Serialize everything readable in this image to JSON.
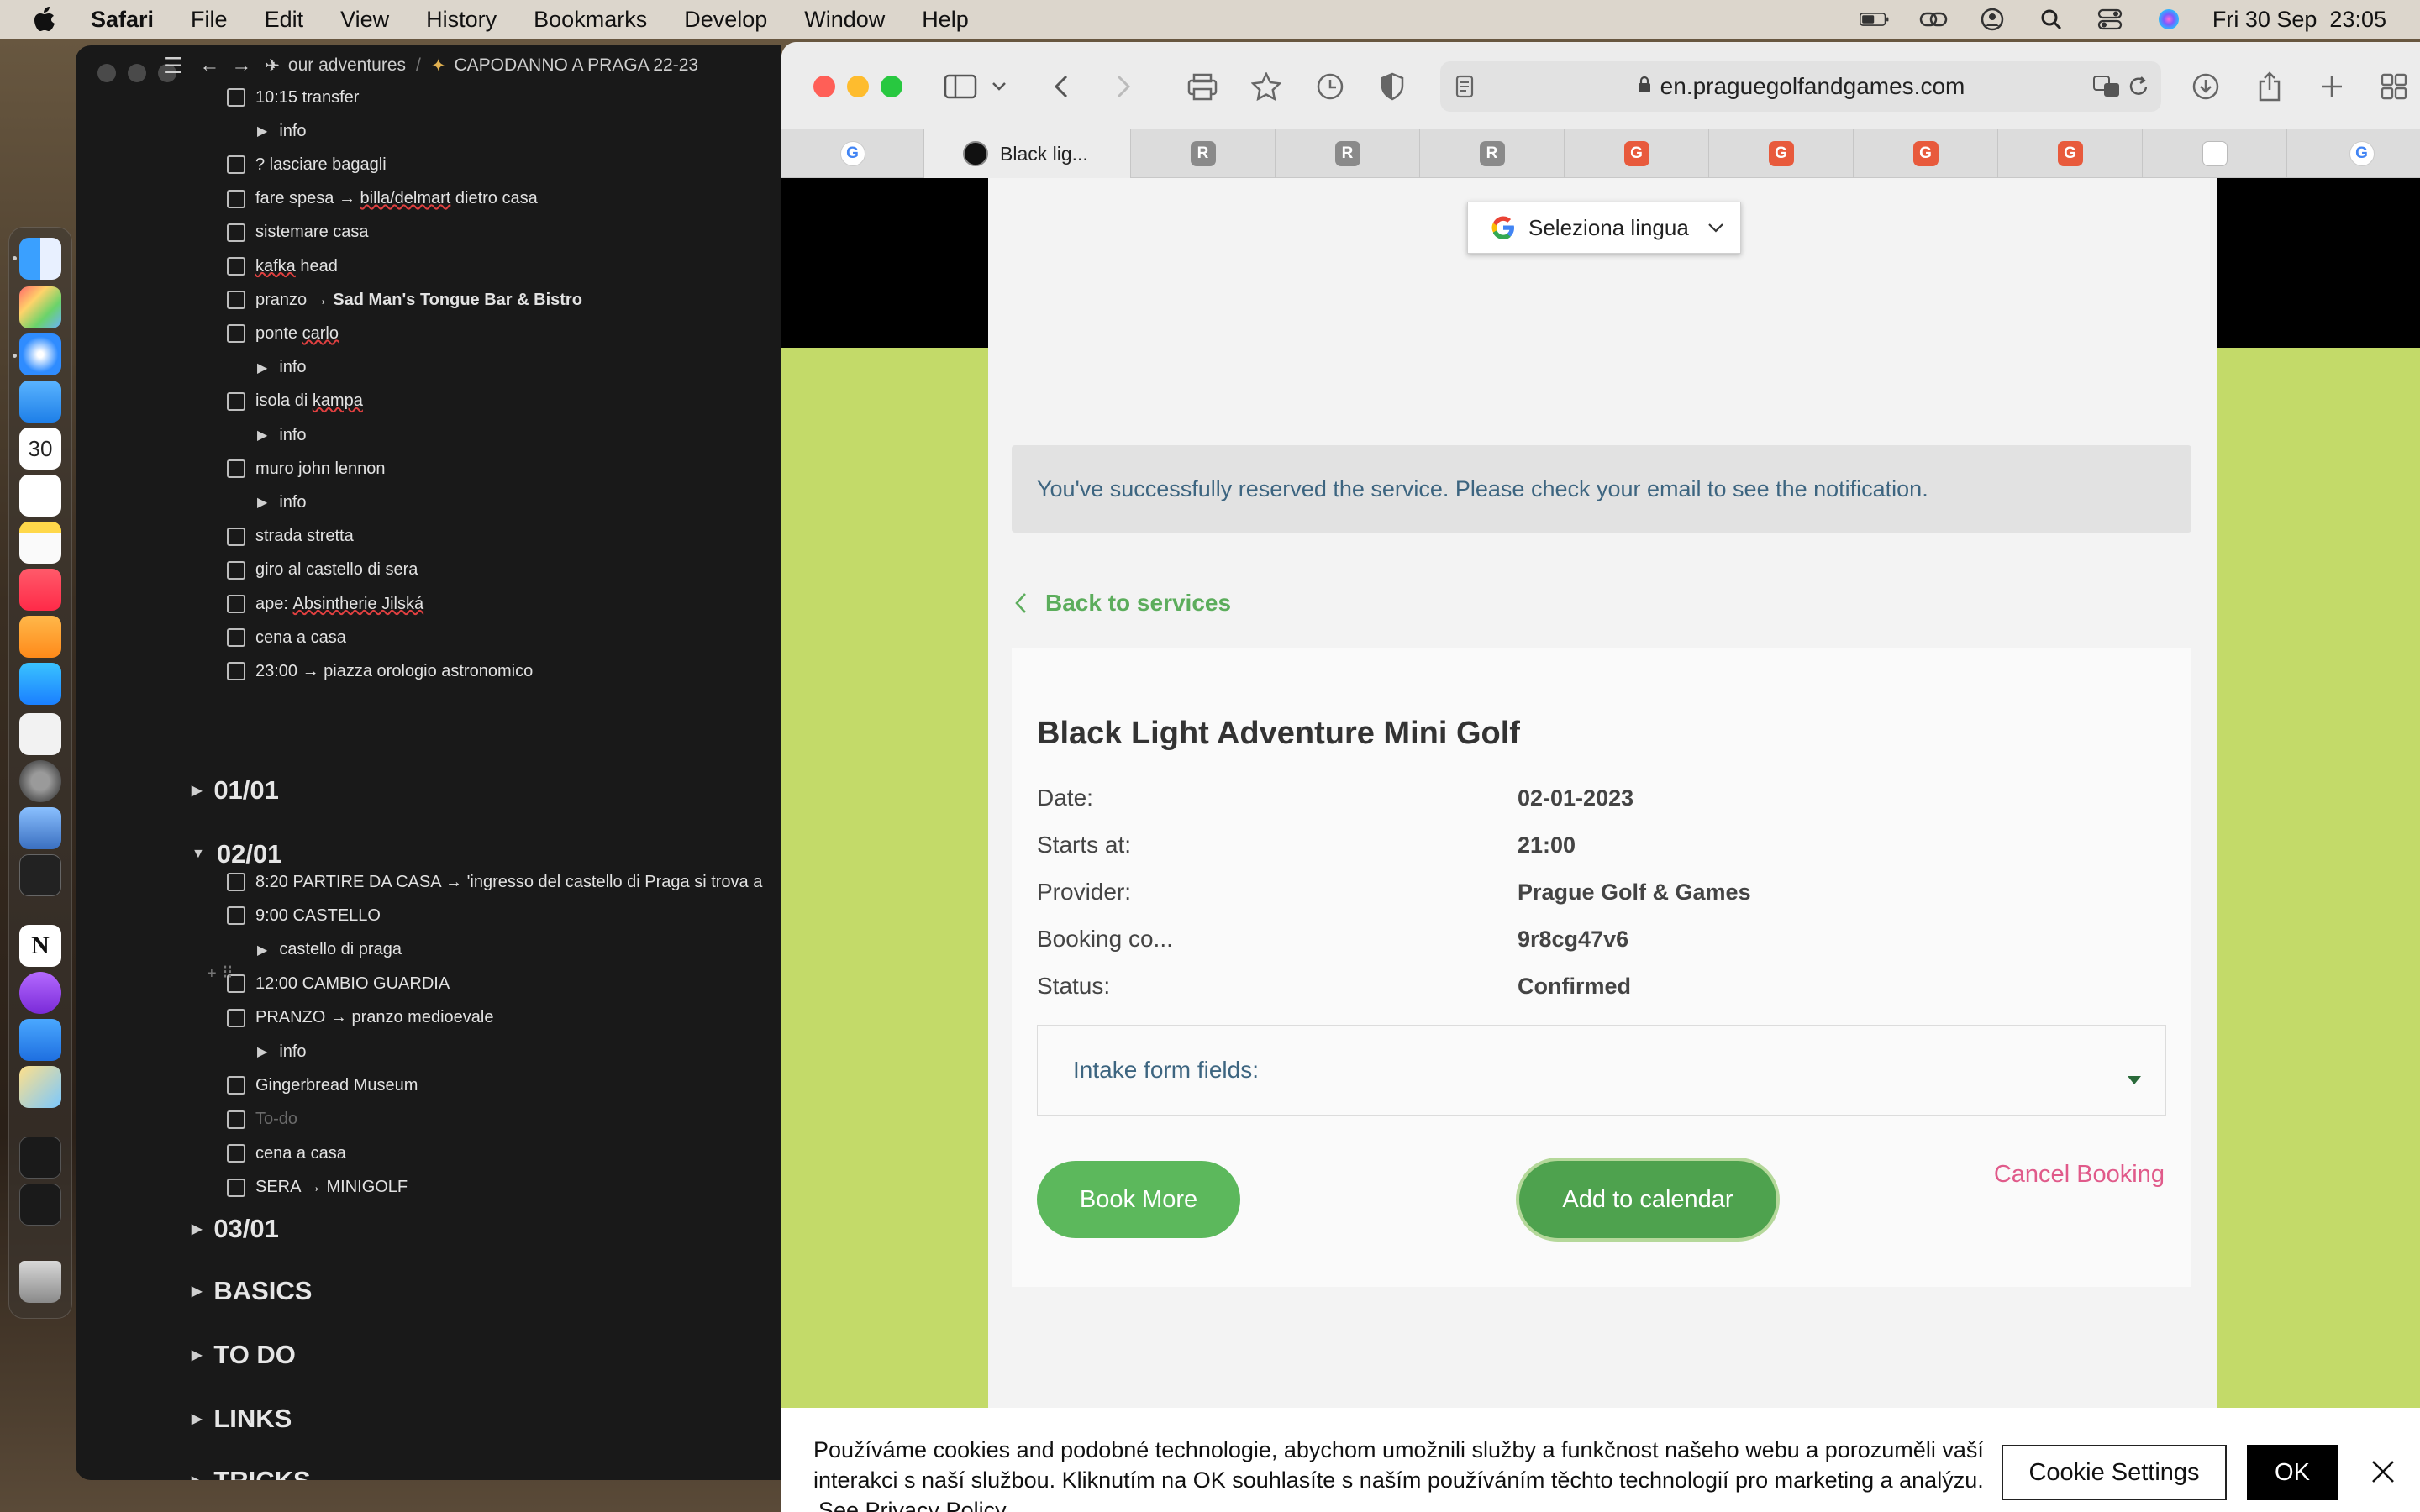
{
  "menubar": {
    "app_name": "Safari",
    "items": [
      "File",
      "Edit",
      "View",
      "History",
      "Bookmarks",
      "Develop",
      "Window",
      "Help"
    ],
    "clock": "Fri 30 Sep  23:05"
  },
  "dock": {
    "calendar_day": "30",
    "apps": [
      "finder",
      "launchpad",
      "safari",
      "mail",
      "calendar",
      "reminders",
      "notes",
      "music",
      "pages",
      "app-store",
      "textedit",
      "system-preferences",
      "preview",
      "terminal",
      "notion",
      "podcasts",
      "keynote",
      "other",
      "window-1",
      "window-2",
      "trash"
    ]
  },
  "notion": {
    "breadcrumb": [
      "our adventures",
      "CAPODANNO A PRAGA 22-23"
    ],
    "rows_a": [
      {
        "type": "todo",
        "text": "10:15 transfer"
      },
      {
        "type": "toggle",
        "text": "info"
      },
      {
        "type": "todo",
        "text": "? lasciare bagagli"
      },
      {
        "type": "todo",
        "text_pre": "fare spesa → ",
        "text_ul": "billa/delmart",
        "text_post": " dietro casa"
      },
      {
        "type": "todo",
        "text": "sistemare casa"
      },
      {
        "type": "todo",
        "text_ul": "kafka",
        "text_post": " head"
      },
      {
        "type": "todo",
        "text_pre": "pranzo → ",
        "text_bold": "Sad Man's Tongue Bar & Bistro"
      },
      {
        "type": "todo",
        "text_pre": "ponte ",
        "text_ul": "carlo"
      },
      {
        "type": "toggle",
        "text": "info"
      },
      {
        "type": "todo",
        "text_pre": "isola di ",
        "text_ul": "kampa"
      },
      {
        "type": "toggle",
        "text": "info"
      },
      {
        "type": "todo",
        "text": "muro john lennon"
      },
      {
        "type": "toggle",
        "text": "info"
      },
      {
        "type": "todo",
        "text": "strada stretta"
      },
      {
        "type": "todo",
        "text": "giro al castello di sera"
      },
      {
        "type": "todo",
        "text_pre": "ape: ",
        "text_ul": "Absintherie Jilská"
      },
      {
        "type": "todo",
        "text": "cena a casa"
      },
      {
        "type": "todo",
        "text": "23:00 → piazza orologio astronomico"
      }
    ],
    "sections": {
      "s1": "01/01",
      "s2": "02/01",
      "s3": "03/01",
      "s4": "BASICS",
      "s5": "TO DO",
      "s6": "LINKS",
      "s7": "TRICKS"
    },
    "rows_b": [
      {
        "type": "todo",
        "text": "8:20 PARTIRE DA CASA → 'ingresso del castello di Praga si trova a"
      },
      {
        "type": "todo",
        "text": "9:00 CASTELLO"
      },
      {
        "type": "toggle",
        "text": "castello di praga"
      },
      {
        "type": "todo",
        "text": "12:00 CAMBIO GUARDIA"
      },
      {
        "type": "todo",
        "text": "PRANZO → pranzo medioevale"
      },
      {
        "type": "toggle",
        "text": "info"
      },
      {
        "type": "todo",
        "text": "Gingerbread Museum"
      },
      {
        "type": "placeholder",
        "text": "To-do"
      },
      {
        "type": "todo",
        "text": "cena a casa"
      },
      {
        "type": "todo",
        "text": "SERA → MINIGOLF"
      }
    ]
  },
  "safari": {
    "url": "en.praguegolfandgames.com",
    "active_tab_title": "Black lig...",
    "tabs": [
      {
        "fav": "G",
        "color": "#ffffff",
        "kind": "google"
      },
      {
        "fav": "",
        "color": "#111111",
        "kind": "active"
      },
      {
        "fav": "R",
        "color": "#8a8a8a",
        "kind": "r"
      },
      {
        "fav": "R",
        "color": "#8a8a8a",
        "kind": "r"
      },
      {
        "fav": "R",
        "color": "#8a8a8a",
        "kind": "r"
      },
      {
        "fav": "G",
        "color": "#e85a3c",
        "kind": "g-orange"
      },
      {
        "fav": "G",
        "color": "#e85a3c",
        "kind": "g-orange"
      },
      {
        "fav": "G",
        "color": "#e85a3c",
        "kind": "g-orange"
      },
      {
        "fav": "G",
        "color": "#e85a3c",
        "kind": "g-orange"
      },
      {
        "fav": "",
        "color": "#ffffff",
        "kind": "misc"
      },
      {
        "fav": "G",
        "color": "#ffffff",
        "kind": "google"
      }
    ]
  },
  "web": {
    "language_select": "Seleziona lingua",
    "alert": "You've successfully reserved the service. Please check your email to see the notification.",
    "back_link": "Back to services",
    "booking": {
      "title": "Black Light Adventure Mini Golf",
      "fields": [
        {
          "label": "Date:",
          "value": "02-01-2023"
        },
        {
          "label": "Starts at:",
          "value": "21:00"
        },
        {
          "label": "Provider:",
          "value": "Prague Golf & Games"
        },
        {
          "label": "Booking co...",
          "value": "9r8cg47v6"
        },
        {
          "label": "Status:",
          "value": "Confirmed"
        }
      ],
      "intake_label": "Intake form fields:",
      "book_more": "Book More",
      "add_calendar": "Add to calendar",
      "cancel": "Cancel Booking"
    },
    "cookie": {
      "text": "Používáme cookies and podobné technologie, abychom umožnili služby a funkčnost našeho webu a porozuměli vaší interakci s naší službou. Kliknutím na OK souhlasíte s naším používáním těchto technologií pro marketing a analýzu.",
      "link": "See Privacy Policy",
      "settings": "Cookie Settings",
      "ok": "OK"
    }
  },
  "colors": {
    "brand_green": "#5cb85c",
    "page_lime": "#c3da69",
    "alert_text": "#3d6580",
    "cancel_pink": "#e05a8a"
  }
}
